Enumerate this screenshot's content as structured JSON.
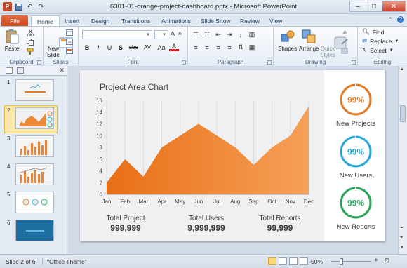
{
  "window": {
    "title": "6301-01-orange-project-dashboard.pptx - Microsoft PowerPoint",
    "minimize": "–",
    "maximize": "□",
    "close": "✕"
  },
  "qat": {
    "app_icon": "P",
    "undo": "↶",
    "redo": "↷"
  },
  "tabs": [
    "File",
    "Home",
    "Insert",
    "Design",
    "Transitions",
    "Animations",
    "Slide Show",
    "Review",
    "View"
  ],
  "ribbon": {
    "clipboard": {
      "label": "Clipboard",
      "paste": "Paste"
    },
    "slides": {
      "label": "Slides",
      "new_slide": "New\nSlide"
    },
    "font": {
      "label": "Font",
      "bold": "B",
      "italic": "I",
      "underline": "U",
      "strike": "S",
      "shadow": "abc",
      "spacing": "AV",
      "case": "Aa",
      "color": "A",
      "grow": "A",
      "shrink": "A"
    },
    "paragraph": {
      "label": "Paragraph"
    },
    "drawing": {
      "label": "Drawing",
      "shapes": "Shapes",
      "arrange": "Arrange",
      "quick_styles": "Quick\nStyles"
    },
    "editing": {
      "label": "Editing",
      "find": "Find",
      "replace": "Replace",
      "select": "Select"
    }
  },
  "slides_panel": {
    "slide_numbers": [
      "1",
      "2",
      "3",
      "4",
      "5",
      "6"
    ],
    "selected": 2
  },
  "slide": {
    "chart_title": "Project Area Chart",
    "stats": [
      {
        "label": "Total Project",
        "value": "999,999"
      },
      {
        "label": "Total Users",
        "value": "9,999,999"
      },
      {
        "label": "Total Reports",
        "value": "99,999"
      }
    ],
    "kpis": [
      {
        "value": "99%",
        "label": "New Projects",
        "color": "#e17b24",
        "fraction": 0.99
      },
      {
        "value": "99%",
        "label": "New Users",
        "color": "#26a9d6",
        "fraction": 0.99
      },
      {
        "value": "99%",
        "label": "New Reports",
        "color": "#28a55a",
        "fraction": 0.99
      }
    ]
  },
  "chart_data": {
    "type": "area",
    "title": "Project Area Chart",
    "categories": [
      "Jan",
      "Feb",
      "Mar",
      "Apr",
      "May",
      "Jun",
      "Jul",
      "Aug",
      "Sep",
      "Oct",
      "Nov",
      "Dec"
    ],
    "values": [
      2,
      6,
      3,
      8,
      10,
      12,
      10,
      8,
      5,
      8,
      10,
      15
    ],
    "ylim": [
      0,
      16
    ],
    "yticks": [
      0,
      2,
      4,
      6,
      8,
      10,
      12,
      14,
      16
    ],
    "grid": true,
    "colors": {
      "fill_start": "#e86f16",
      "fill_end": "#f6a058"
    }
  },
  "status": {
    "slide_info": "Slide 2 of 6",
    "theme": "\"Office Theme\"",
    "zoom": "50%",
    "zoom_minus": "−",
    "zoom_plus": "+"
  }
}
